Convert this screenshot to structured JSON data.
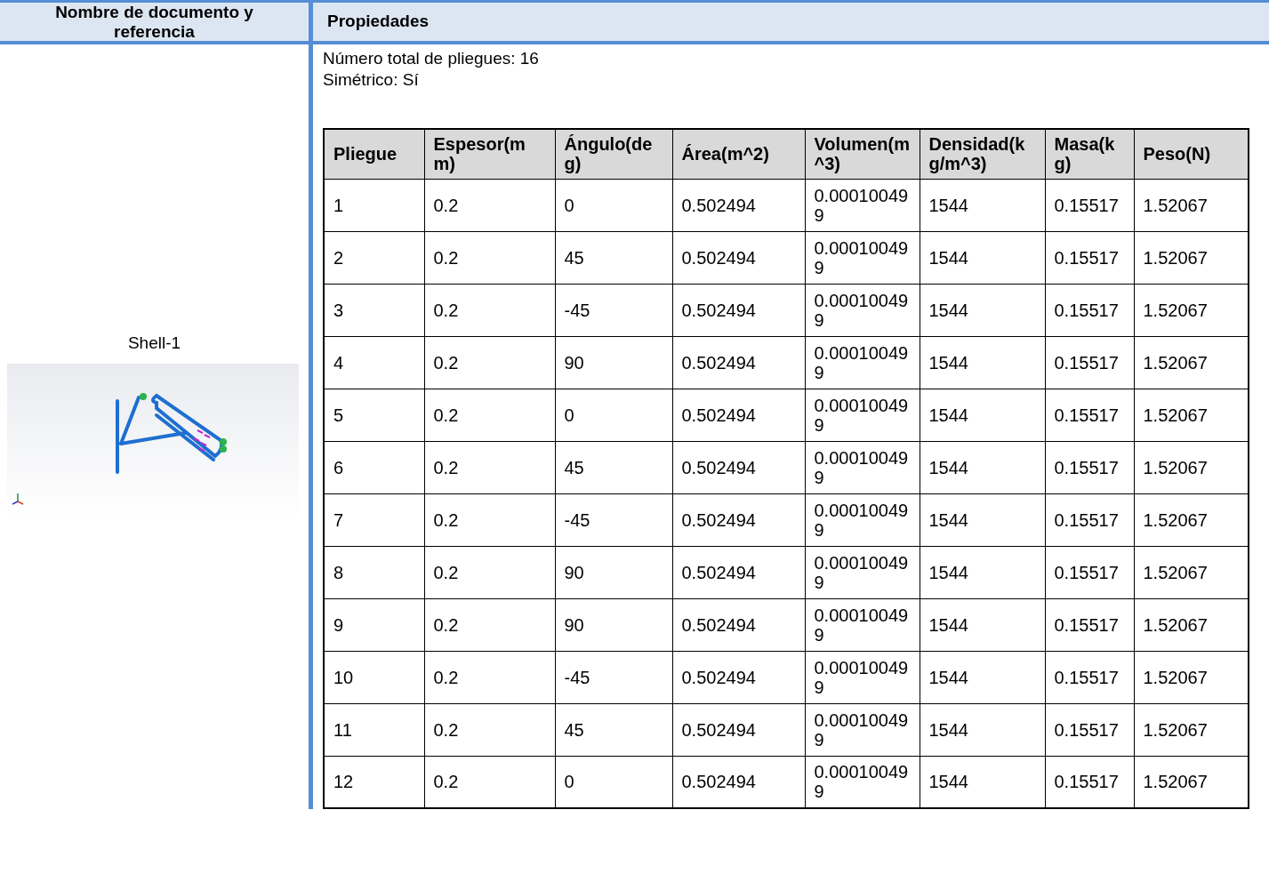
{
  "headers": [
    "Nombre de documento y referencia",
    "Propiedades"
  ],
  "document": {
    "name": "Shell-1"
  },
  "properties": [
    "Número total de pliegues: 16",
    "Simétrico: Sí"
  ],
  "table": {
    "columns": [
      "Pliegue",
      "Espesor(mm)",
      "Ángulo(deg)",
      "Área(m^2)",
      "Volumen(m^3)",
      "Densidad(kg/m^3)",
      "Masa(kg)",
      "Peso(N)"
    ],
    "rows": [
      [
        "1",
        "0.2",
        "0",
        "0.502494",
        "0.000100499",
        "1544",
        "0.15517",
        "1.52067"
      ],
      [
        "2",
        "0.2",
        "45",
        "0.502494",
        "0.000100499",
        "1544",
        "0.15517",
        "1.52067"
      ],
      [
        "3",
        "0.2",
        "-45",
        "0.502494",
        "0.000100499",
        "1544",
        "0.15517",
        "1.52067"
      ],
      [
        "4",
        "0.2",
        "90",
        "0.502494",
        "0.000100499",
        "1544",
        "0.15517",
        "1.52067"
      ],
      [
        "5",
        "0.2",
        "0",
        "0.502494",
        "0.000100499",
        "1544",
        "0.15517",
        "1.52067"
      ],
      [
        "6",
        "0.2",
        "45",
        "0.502494",
        "0.000100499",
        "1544",
        "0.15517",
        "1.52067"
      ],
      [
        "7",
        "0.2",
        "-45",
        "0.502494",
        "0.000100499",
        "1544",
        "0.15517",
        "1.52067"
      ],
      [
        "8",
        "0.2",
        "90",
        "0.502494",
        "0.000100499",
        "1544",
        "0.15517",
        "1.52067"
      ],
      [
        "9",
        "0.2",
        "90",
        "0.502494",
        "0.000100499",
        "1544",
        "0.15517",
        "1.52067"
      ],
      [
        "10",
        "0.2",
        "-45",
        "0.502494",
        "0.000100499",
        "1544",
        "0.15517",
        "1.52067"
      ],
      [
        "11",
        "0.2",
        "45",
        "0.502494",
        "0.000100499",
        "1544",
        "0.15517",
        "1.52067"
      ],
      [
        "12",
        "0.2",
        "0",
        "0.502494",
        "0.000100499",
        "1544",
        "0.15517",
        "1.52067"
      ]
    ]
  }
}
